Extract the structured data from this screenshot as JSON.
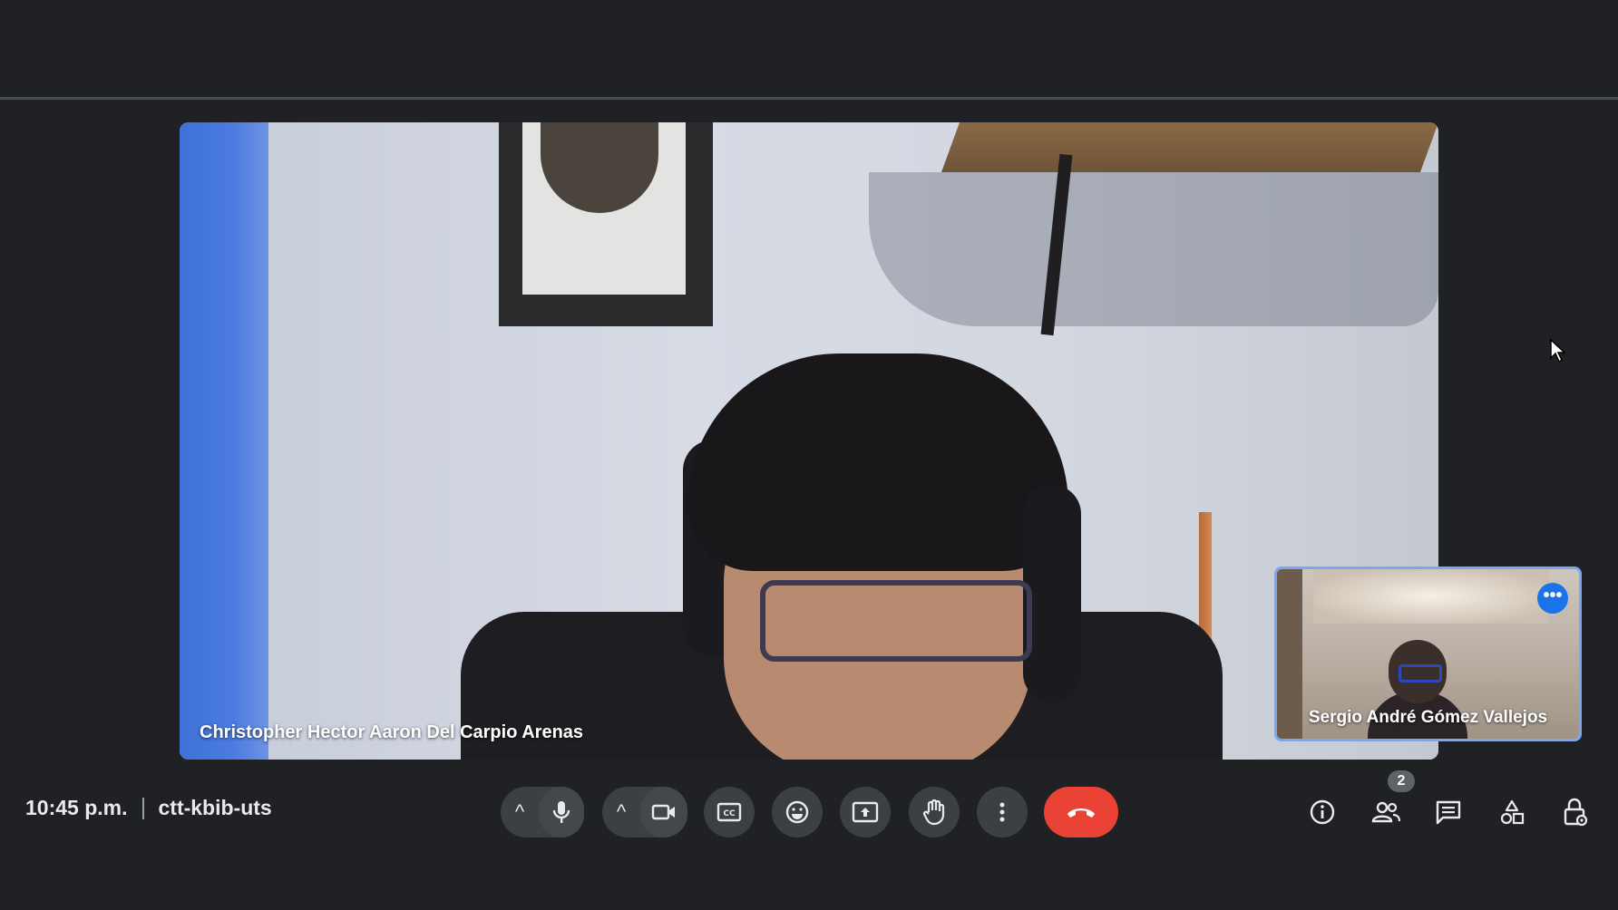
{
  "meeting": {
    "time": "10:45 p.m.",
    "code": "ctt-kbib-uts"
  },
  "main_participant": {
    "name": "Christopher Hector Aaron Del Carpio Arenas"
  },
  "self_tile": {
    "name": "Sergio André Gómez Vallejos",
    "more_label": "•••"
  },
  "controls": {
    "mic_caret": "^",
    "camera_caret": "^",
    "icons": [
      "microphone-icon",
      "camera-icon",
      "captions-icon",
      "emoji-icon",
      "present-icon",
      "raise-hand-icon",
      "more-vert-icon",
      "end-call-icon"
    ]
  },
  "side_panel": {
    "people_count": "2",
    "icons": [
      "info-icon",
      "people-icon",
      "chat-icon",
      "activities-icon",
      "host-controls-icon"
    ]
  },
  "colors": {
    "background": "#202124",
    "control_bg": "#3c4043",
    "end_call": "#ea4335",
    "accent": "#1a73e8",
    "self_tile_border": "#7aa6f5"
  }
}
